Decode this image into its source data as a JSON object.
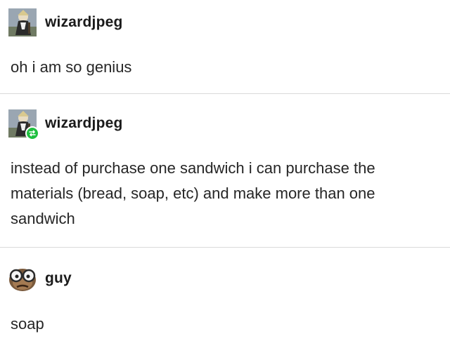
{
  "posts": [
    {
      "username": "wizardjpeg",
      "text": "oh i am so genius",
      "avatar": "wizard-avatar",
      "reblog": false
    },
    {
      "username": "wizardjpeg",
      "text": "instead of purchase one sandwich i can purchase the materials (bread, soap, etc) and make more than one sandwich",
      "avatar": "wizard-avatar",
      "reblog": true
    },
    {
      "username": "guy",
      "text": "soap",
      "avatar": "glasses-face-avatar",
      "reblog": false
    }
  ],
  "colors": {
    "reblog_badge": "#1fbf3f",
    "divider": "#d9d9d9"
  }
}
